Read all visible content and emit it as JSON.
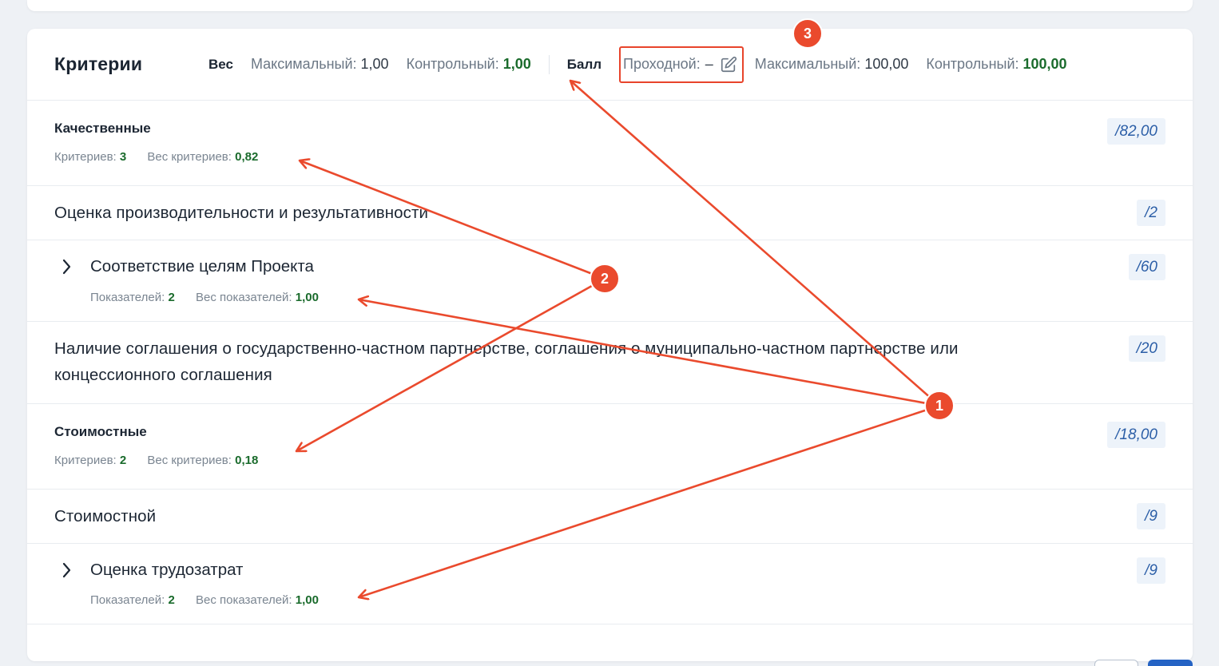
{
  "header": {
    "title": "Критерии",
    "weight_label": "Вес",
    "weight_max_label": "Максимальный:",
    "weight_max_value": "1,00",
    "weight_control_label": "Контрольный:",
    "weight_control_value": "1,00",
    "score_label": "Балл",
    "passing_label": "Проходной:",
    "passing_value": "–",
    "score_max_label": "Максимальный:",
    "score_max_value": "100,00",
    "score_control_label": "Контрольный:",
    "score_control_value": "100,00"
  },
  "groups": [
    {
      "name": "Качественные",
      "criteria_count_label": "Критериев:",
      "criteria_count": "3",
      "criteria_weight_label": "Вес критериев:",
      "criteria_weight": "0,82",
      "max": "/82,00"
    },
    {
      "name": "Стоимостные",
      "criteria_count_label": "Критериев:",
      "criteria_count": "2",
      "criteria_weight_label": "Вес критериев:",
      "criteria_weight": "0,18",
      "max": "/18,00"
    }
  ],
  "criteria": [
    {
      "name": "Оценка производительности и результативности",
      "max": "/2"
    },
    {
      "name": "Соответствие целям Проекта",
      "indicators_label": "Показателей:",
      "indicators_count": "2",
      "indicators_weight_label": "Вес показателей:",
      "indicators_weight": "1,00",
      "max": "/60"
    },
    {
      "name_line1": "Наличие соглашения о государственно-частном партнерстве, соглашения о муниципально-частном партнерстве или",
      "name_line2": "концессионного соглашения",
      "max": "/20"
    },
    {
      "name": "Стоимостной",
      "max": "/9"
    },
    {
      "name": "Оценка трудозатрат",
      "indicators_label": "Показателей:",
      "indicators_count": "2",
      "indicators_weight_label": "Вес показателей:",
      "indicators_weight": "1,00",
      "max": "/9"
    }
  ],
  "annotations": {
    "marker_1": "1",
    "marker_2": "2",
    "marker_3": "3",
    "color": "#ea4a2d"
  },
  "colors": {
    "green_value": "#1a6b2c",
    "badge_text": "#2b5ea7",
    "badge_bg": "#edf3fa"
  }
}
